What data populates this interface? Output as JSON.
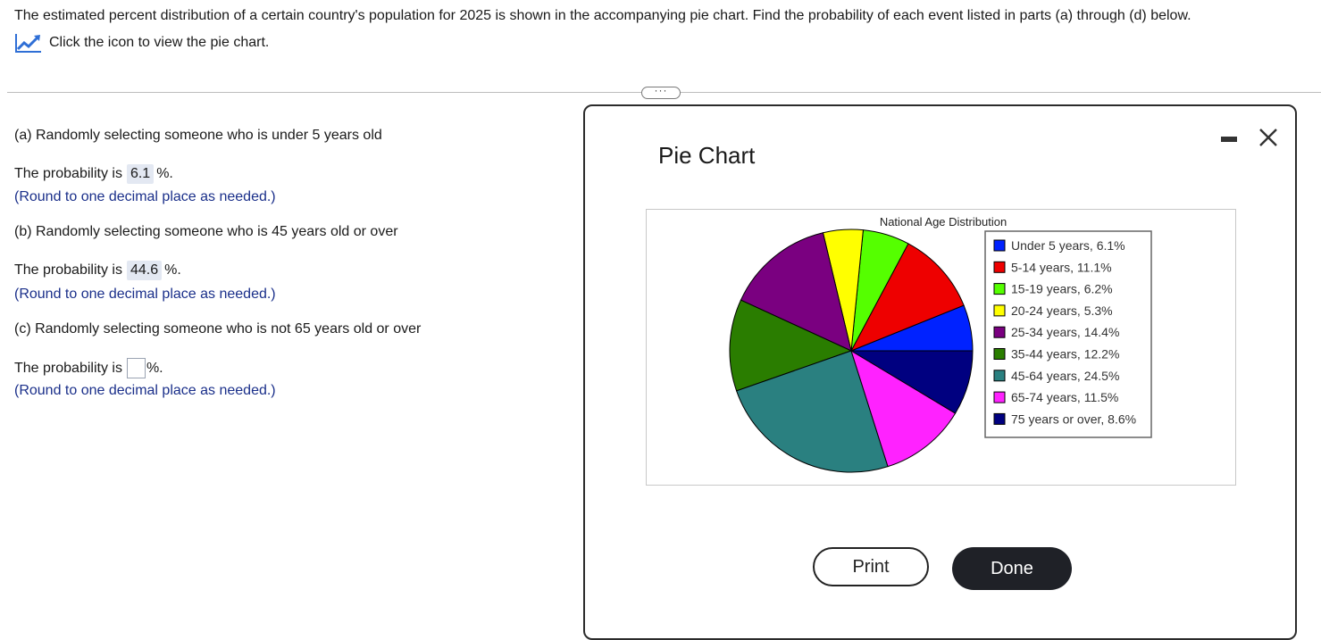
{
  "intro": {
    "text": "The estimated percent distribution of a certain country's population for 2025 is shown in the accompanying pie chart. Find the probability of each event listed in parts (a) through (d) below.",
    "chart_link": "Click the icon to view the pie chart.",
    "chart_link_icon": "line-chart-icon"
  },
  "questions": [
    {
      "prompt": "(a) Randomly selecting someone who is under 5 years old",
      "answer_prefix": "The probability is",
      "answer_value": "6.1",
      "answer_suffix": "%.",
      "hint": "(Round to one decimal place as needed.)"
    },
    {
      "prompt": "(b) Randomly selecting someone who is 45 years old or over",
      "answer_prefix": "The probability is",
      "answer_value": "44.6",
      "answer_suffix": "%.",
      "hint": "(Round to one decimal place as needed.)"
    },
    {
      "prompt": "(c) Randomly selecting someone who is not 65 years old or over",
      "answer_prefix": "The probability is",
      "answer_value": "",
      "answer_suffix": "%.",
      "hint": "(Round to one decimal place as needed.)"
    }
  ],
  "more_button": "···",
  "dialog": {
    "title": "Pie Chart",
    "print_label": "Print",
    "done_label": "Done"
  },
  "chart_data": {
    "type": "pie",
    "title": "National Age Distribution",
    "legend_position": "right",
    "slices": [
      {
        "label": "Under 5 years, 6.1%",
        "value": 6.1,
        "color": "#0022ff"
      },
      {
        "label": "5-14 years, 11.1%",
        "value": 11.1,
        "color": "#ee0000"
      },
      {
        "label": "15-19 years, 6.2%",
        "value": 6.2,
        "color": "#55ff00"
      },
      {
        "label": "20-24 years, 5.3%",
        "value": 5.3,
        "color": "#ffff00"
      },
      {
        "label": "25-34 years, 14.4%",
        "value": 14.4,
        "color": "#7a0080"
      },
      {
        "label": "35-44 years, 12.2%",
        "value": 12.2,
        "color": "#2a7d00"
      },
      {
        "label": "45-64 years, 24.5%",
        "value": 24.5,
        "color": "#2a8080"
      },
      {
        "label": "65-74 years, 11.5%",
        "value": 11.5,
        "color": "#ff22ff"
      },
      {
        "label": "75 years or over, 8.6%",
        "value": 8.6,
        "color": "#000080"
      }
    ]
  }
}
